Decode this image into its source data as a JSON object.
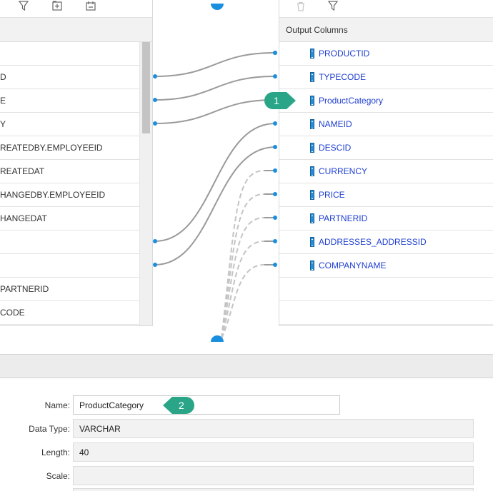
{
  "source_columns": [
    {
      "label": ""
    },
    {
      "label": "D"
    },
    {
      "label": "E"
    },
    {
      "label": "Y"
    },
    {
      "label": "REATEDBY.EMPLOYEEID"
    },
    {
      "label": "REATEDAT"
    },
    {
      "label": "HANGEDBY.EMPLOYEEID"
    },
    {
      "label": "HANGEDAT"
    },
    {
      "label": ""
    },
    {
      "label": ""
    },
    {
      "label": "PARTNERID"
    },
    {
      "label": "CODE"
    }
  ],
  "output_panel": {
    "header": "Output Columns",
    "columns": [
      {
        "name": "PRODUCTID"
      },
      {
        "name": "TYPECODE"
      },
      {
        "name": "ProductCategory"
      },
      {
        "name": "NAMEID"
      },
      {
        "name": "DESCID"
      },
      {
        "name": "CURRENCY"
      },
      {
        "name": "PRICE"
      },
      {
        "name": "PARTNERID"
      },
      {
        "name": "ADDRESSES_ADDRESSID"
      },
      {
        "name": "COMPANYNAME"
      }
    ]
  },
  "properties": {
    "name_label": "Name:",
    "name_value": "ProductCategory",
    "datatype_label": "Data Type:",
    "datatype_value": "VARCHAR",
    "length_label": "Length:",
    "length_value": "40",
    "scale_label": "Scale:",
    "scale_value": ""
  },
  "callouts": {
    "first": "1",
    "second": "2"
  },
  "icons": {
    "left_toolbar": [
      "filter-icon",
      "add-column-icon",
      "calculated-column-icon"
    ],
    "right_toolbar": [
      "delete-icon",
      "filter-icon"
    ]
  },
  "colors": {
    "column_link": "#1f3fd1",
    "connector_dot": "#1a8fe0",
    "callout": "#2aa587",
    "mapping_line": "#9a9a9a"
  }
}
